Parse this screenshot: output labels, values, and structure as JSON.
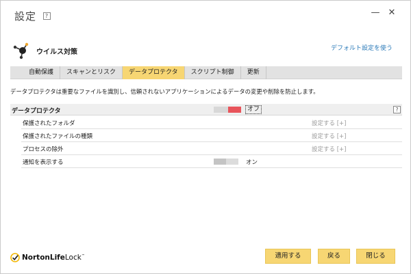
{
  "window": {
    "title": "設定",
    "help_label": "?",
    "minimize_glyph": "—",
    "close_glyph": "✕"
  },
  "section": {
    "title": "ウイルス対策",
    "icon": "antivirus-molecule-icon",
    "default_link": "デフォルト設定を使う"
  },
  "tabs": [
    {
      "label": "自動保護"
    },
    {
      "label": "スキャンとリスク"
    },
    {
      "label": "データプロテクタ",
      "active": true
    },
    {
      "label": "スクリプト制御"
    },
    {
      "label": "更新"
    }
  ],
  "description": "データプロテクタは重要なファイルを識別し、信頼されないアプリケーションによるデータの変更や削除を防止します。",
  "data_protector": {
    "label": "データプロテクタ",
    "state": "オフ",
    "help_label": "?",
    "toggle_color": "#e8545b"
  },
  "rows": [
    {
      "label": "保護されたフォルダ",
      "action": "設定する [+]"
    },
    {
      "label": "保護されたファイルの種類",
      "action": "設定する [+]"
    },
    {
      "label": "プロセスの除外",
      "action": "設定する [+]"
    }
  ],
  "notify": {
    "label": "通知を表示する",
    "state": "オン"
  },
  "footer": {
    "brand_bold": "NortonLife",
    "brand_light": "Lock",
    "brand_tm": "™",
    "apply": "適用する",
    "back": "戻る",
    "close": "閉じる",
    "accent": "#f7d673"
  }
}
